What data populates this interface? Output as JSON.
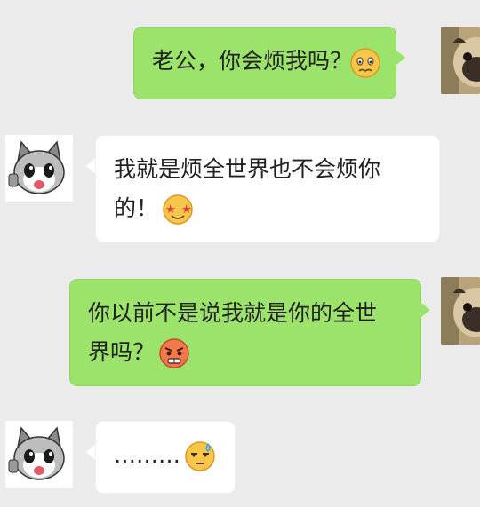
{
  "messages": [
    {
      "sender": "me",
      "lines": [
        "老公，你会烦我吗？"
      ],
      "emoji": "worried-face-icon"
    },
    {
      "sender": "other",
      "lines": [
        "我就是烦全世界也不会烦你",
        "的！"
      ],
      "emoji": "star-eyes-face-icon"
    },
    {
      "sender": "me",
      "lines": [
        "你以前不是说我就是你的全世",
        "界吗？"
      ],
      "emoji": "angry-face-icon"
    },
    {
      "sender": "other",
      "lines": [
        "………"
      ],
      "emoji": "sweat-face-icon"
    }
  ],
  "colors": {
    "background": "#ebebeb",
    "my_bubble": "#9be36a",
    "their_bubble": "#ffffff"
  },
  "avatars": {
    "me": "pug-dog-avatar",
    "other": "cartoon-cat-avatar"
  }
}
